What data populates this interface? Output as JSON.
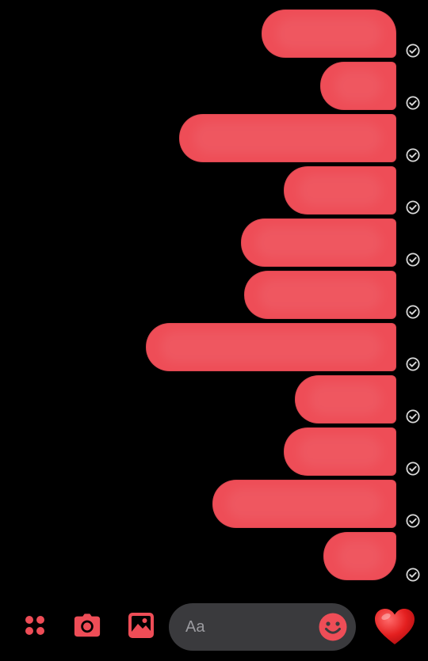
{
  "theme": {
    "accent": "#ee4d57",
    "background": "#000000",
    "input_bg": "#3a3a3d",
    "placeholder_color": "#9b9ba0",
    "check_color": "#d9d9d9"
  },
  "messages": [
    {
      "text": "",
      "status": "sent",
      "status_icon": "check-circle-icon"
    },
    {
      "text": "",
      "status": "sent",
      "status_icon": "check-circle-icon"
    },
    {
      "text": "",
      "status": "sent",
      "status_icon": "check-circle-icon"
    },
    {
      "text": "",
      "status": "sent",
      "status_icon": "check-circle-icon"
    },
    {
      "text": "",
      "status": "sent",
      "status_icon": "check-circle-icon"
    },
    {
      "text": "",
      "status": "sent",
      "status_icon": "check-circle-icon"
    },
    {
      "text": "",
      "status": "sent",
      "status_icon": "check-circle-icon"
    },
    {
      "text": "",
      "status": "sent",
      "status_icon": "check-circle-icon"
    },
    {
      "text": "",
      "status": "sent",
      "status_icon": "check-circle-icon"
    },
    {
      "text": "",
      "status": "sent",
      "status_icon": "check-circle-icon"
    },
    {
      "text": "",
      "status": "sent",
      "status_icon": "check-circle-icon"
    }
  ],
  "composer": {
    "placeholder": "Aa",
    "icons": {
      "apps": "apps-grid-icon",
      "camera": "camera-icon",
      "gallery": "image-gallery-icon",
      "emoji": "smiley-emoji-icon",
      "like": "heart-icon"
    }
  }
}
